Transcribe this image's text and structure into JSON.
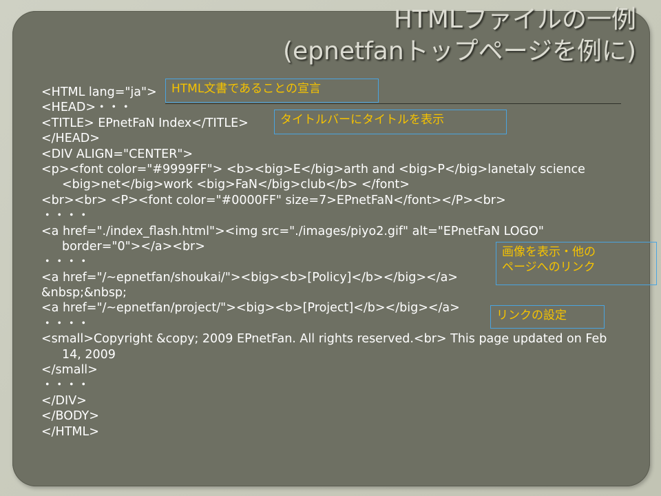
{
  "slide": {
    "title_line1": "HTMLファイルの一例",
    "title_line2": "(epnetfanトップページを例に)"
  },
  "code_lines": [
    "<HTML lang=\"ja\">",
    "<HEAD>・・・",
    "<TITLE> EPnetFaN Index</TITLE>",
    "</HEAD>",
    "<DIV ALIGN=\"CENTER\">",
    "<p><font color=\"#9999FF\"> <b><big>E</big>arth and <big>P</big>lanetaly science",
    "<big>net</big>work <big>FaN</big>club</b> </font>",
    "<br><br> <P><font color=\"#0000FF\" size=7>EPnetFaN</font></P><br>",
    "・・・・",
    "<a href=\"./index_flash.html\"><img src=\"./images/piyo2.gif\" alt=\"EPnetFaN LOGO\"",
    "border=\"0\"></a><br>",
    "・・・・",
    "<a href=\"/~epnetfan/shoukai/\"><big><b>[Policy]</b></big></a>",
    "&nbsp;&nbsp;",
    "<a href=\"/~epnetfan/project/\"><big><b>[Project]</b></big></a>",
    "・・・・",
    "<small>Copyright &copy; 2009 EPnetFan. All rights reserved.<br> This page updated on Feb",
    "14, 2009",
    "</small>",
    "・・・・",
    "</DIV>",
    "</BODY>",
    "</HTML>"
  ],
  "annotations": {
    "html_declaration": "HTML文書であることの宣言",
    "title_bar": "タイトルバーにタイトルを表示",
    "image_link_line1": "画像を表示・他の",
    "image_link_line2": "ページへのリンク",
    "link_setting": "リンクの設定"
  }
}
